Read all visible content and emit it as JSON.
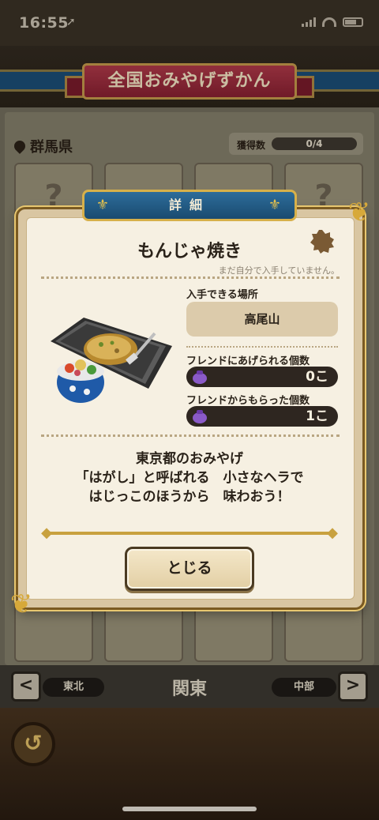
{
  "status_bar": {
    "time": "16:55"
  },
  "screen": {
    "title": "全国おみやげずかん",
    "prefecture": "群馬県",
    "obtained_label": "獲得数",
    "obtained_value": "0/4",
    "placeholder_mark": "?"
  },
  "modal": {
    "header": "詳細",
    "item_name": "もんじゃ焼き",
    "not_obtained_note": "まだ自分で入手していません。",
    "location_label": "入手できる場所",
    "location_value": "高尾山",
    "giftable_label": "フレンドにあげられる個数",
    "giftable_value": "0こ",
    "received_label": "フレンドからもらった個数",
    "received_value": "1こ",
    "description": {
      "line1": "東京都のおみやげ",
      "line2": "「はがし」と呼ばれる　小さなヘラで",
      "line3": "はじっこのほうから　味わおう！"
    },
    "close_label": "とじる"
  },
  "bottom_nav": {
    "prev_region": "東北",
    "current_region": "関東",
    "next_region": "中部",
    "prev_arrow": "<",
    "next_arrow": ">"
  },
  "icons": [
    "location-pin-icon",
    "gear-icon",
    "bag-icon",
    "back-icon",
    "chevron-left-icon",
    "chevron-right-icon"
  ],
  "colors": {
    "accent_gold": "#c8a13f",
    "header_blue": "#1a4b70",
    "ribbon_red": "#8a2132"
  }
}
